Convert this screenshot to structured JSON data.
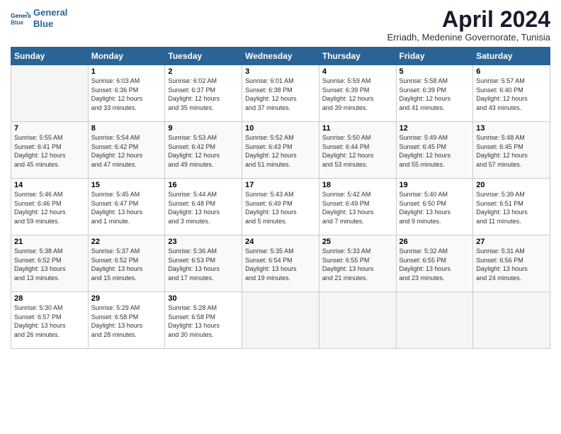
{
  "header": {
    "logo_line1": "General",
    "logo_line2": "Blue",
    "title": "April 2024",
    "subtitle": "Erriadh, Medenine Governorate, Tunisia"
  },
  "weekdays": [
    "Sunday",
    "Monday",
    "Tuesday",
    "Wednesday",
    "Thursday",
    "Friday",
    "Saturday"
  ],
  "rows": [
    [
      {
        "day": "",
        "info": ""
      },
      {
        "day": "1",
        "info": "Sunrise: 6:03 AM\nSunset: 6:36 PM\nDaylight: 12 hours\nand 33 minutes."
      },
      {
        "day": "2",
        "info": "Sunrise: 6:02 AM\nSunset: 6:37 PM\nDaylight: 12 hours\nand 35 minutes."
      },
      {
        "day": "3",
        "info": "Sunrise: 6:01 AM\nSunset: 6:38 PM\nDaylight: 12 hours\nand 37 minutes."
      },
      {
        "day": "4",
        "info": "Sunrise: 5:59 AM\nSunset: 6:39 PM\nDaylight: 12 hours\nand 39 minutes."
      },
      {
        "day": "5",
        "info": "Sunrise: 5:58 AM\nSunset: 6:39 PM\nDaylight: 12 hours\nand 41 minutes."
      },
      {
        "day": "6",
        "info": "Sunrise: 5:57 AM\nSunset: 6:40 PM\nDaylight: 12 hours\nand 43 minutes."
      }
    ],
    [
      {
        "day": "7",
        "info": "Sunrise: 5:55 AM\nSunset: 6:41 PM\nDaylight: 12 hours\nand 45 minutes."
      },
      {
        "day": "8",
        "info": "Sunrise: 5:54 AM\nSunset: 6:42 PM\nDaylight: 12 hours\nand 47 minutes."
      },
      {
        "day": "9",
        "info": "Sunrise: 5:53 AM\nSunset: 6:42 PM\nDaylight: 12 hours\nand 49 minutes."
      },
      {
        "day": "10",
        "info": "Sunrise: 5:52 AM\nSunset: 6:43 PM\nDaylight: 12 hours\nand 51 minutes."
      },
      {
        "day": "11",
        "info": "Sunrise: 5:50 AM\nSunset: 6:44 PM\nDaylight: 12 hours\nand 53 minutes."
      },
      {
        "day": "12",
        "info": "Sunrise: 5:49 AM\nSunset: 6:45 PM\nDaylight: 12 hours\nand 55 minutes."
      },
      {
        "day": "13",
        "info": "Sunrise: 5:48 AM\nSunset: 6:45 PM\nDaylight: 12 hours\nand 57 minutes."
      }
    ],
    [
      {
        "day": "14",
        "info": "Sunrise: 5:46 AM\nSunset: 6:46 PM\nDaylight: 12 hours\nand 59 minutes."
      },
      {
        "day": "15",
        "info": "Sunrise: 5:45 AM\nSunset: 6:47 PM\nDaylight: 13 hours\nand 1 minute."
      },
      {
        "day": "16",
        "info": "Sunrise: 5:44 AM\nSunset: 6:48 PM\nDaylight: 13 hours\nand 3 minutes."
      },
      {
        "day": "17",
        "info": "Sunrise: 5:43 AM\nSunset: 6:49 PM\nDaylight: 13 hours\nand 5 minutes."
      },
      {
        "day": "18",
        "info": "Sunrise: 5:42 AM\nSunset: 6:49 PM\nDaylight: 13 hours\nand 7 minutes."
      },
      {
        "day": "19",
        "info": "Sunrise: 5:40 AM\nSunset: 6:50 PM\nDaylight: 13 hours\nand 9 minutes."
      },
      {
        "day": "20",
        "info": "Sunrise: 5:39 AM\nSunset: 6:51 PM\nDaylight: 13 hours\nand 11 minutes."
      }
    ],
    [
      {
        "day": "21",
        "info": "Sunrise: 5:38 AM\nSunset: 6:52 PM\nDaylight: 13 hours\nand 13 minutes."
      },
      {
        "day": "22",
        "info": "Sunrise: 5:37 AM\nSunset: 6:52 PM\nDaylight: 13 hours\nand 15 minutes."
      },
      {
        "day": "23",
        "info": "Sunrise: 5:36 AM\nSunset: 6:53 PM\nDaylight: 13 hours\nand 17 minutes."
      },
      {
        "day": "24",
        "info": "Sunrise: 5:35 AM\nSunset: 6:54 PM\nDaylight: 13 hours\nand 19 minutes."
      },
      {
        "day": "25",
        "info": "Sunrise: 5:33 AM\nSunset: 6:55 PM\nDaylight: 13 hours\nand 21 minutes."
      },
      {
        "day": "26",
        "info": "Sunrise: 5:32 AM\nSunset: 6:55 PM\nDaylight: 13 hours\nand 23 minutes."
      },
      {
        "day": "27",
        "info": "Sunrise: 5:31 AM\nSunset: 6:56 PM\nDaylight: 13 hours\nand 24 minutes."
      }
    ],
    [
      {
        "day": "28",
        "info": "Sunrise: 5:30 AM\nSunset: 6:57 PM\nDaylight: 13 hours\nand 26 minutes."
      },
      {
        "day": "29",
        "info": "Sunrise: 5:29 AM\nSunset: 6:58 PM\nDaylight: 13 hours\nand 28 minutes."
      },
      {
        "day": "30",
        "info": "Sunrise: 5:28 AM\nSunset: 6:58 PM\nDaylight: 13 hours\nand 30 minutes."
      },
      {
        "day": "",
        "info": ""
      },
      {
        "day": "",
        "info": ""
      },
      {
        "day": "",
        "info": ""
      },
      {
        "day": "",
        "info": ""
      }
    ]
  ]
}
